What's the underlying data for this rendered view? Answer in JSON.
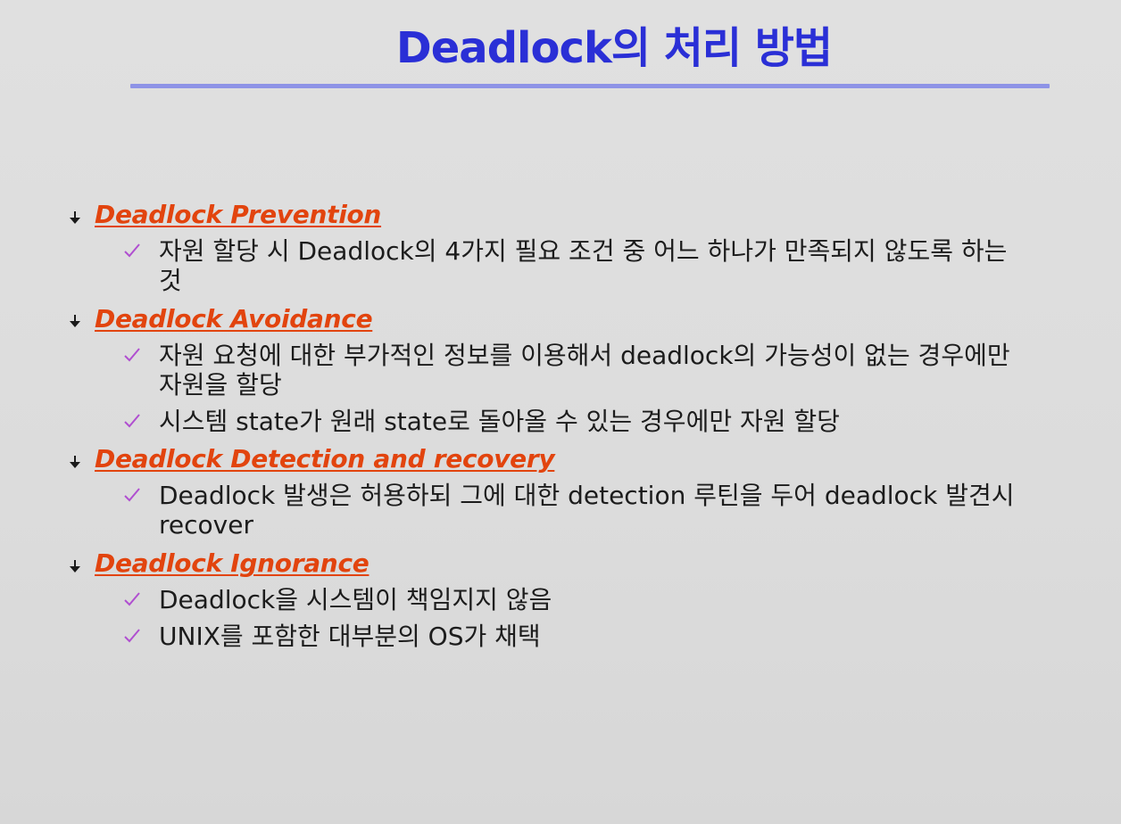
{
  "slide": {
    "title": "Deadlock의 처리 방법",
    "colors": {
      "title": "#2a2fd6",
      "title_rule": "#8e93e6",
      "heading": "#e2440e",
      "check": "#b04fd0",
      "body_text": "#1c1c1c",
      "background": "#dedede"
    },
    "sections": [
      {
        "heading": "Deadlock Prevention",
        "items": [
          "자원 할당 시 Deadlock의 4가지 필요 조건 중 어느 하나가 만족되지 않도록 하는 것"
        ]
      },
      {
        "heading": "Deadlock Avoidance",
        "items": [
          "자원 요청에 대한 부가적인 정보를 이용해서 deadlock의 가능성이 없는 경우에만 자원을 할당",
          "시스템 state가 원래 state로 돌아올 수 있는 경우에만 자원 할당"
        ]
      },
      {
        "heading": "Deadlock Detection and recovery",
        "items": [
          "Deadlock 발생은 허용하되 그에 대한 detection 루틴을 두어 deadlock 발견시 recover"
        ]
      },
      {
        "heading": "Deadlock Ignorance",
        "items": [
          "Deadlock을 시스템이 책임지지 않음",
          "UNIX를 포함한 대부분의 OS가 채택"
        ]
      }
    ]
  }
}
